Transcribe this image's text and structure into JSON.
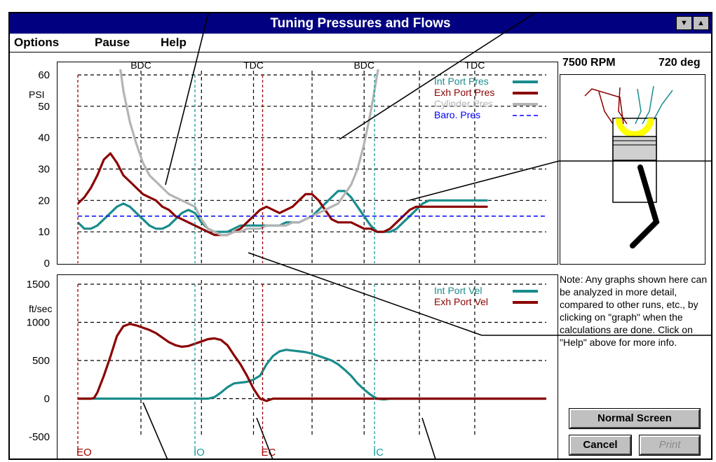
{
  "window": {
    "title": "Tuning Pressures and Flows",
    "minimize_glyph": "▼",
    "maximize_glyph": "▲"
  },
  "menu": {
    "items": [
      {
        "id": "options",
        "label": "Options"
      },
      {
        "id": "pause",
        "label": "Pause"
      },
      {
        "id": "help",
        "label": "Help"
      }
    ]
  },
  "status": {
    "rpm": "7500 RPM",
    "deg": "720 deg"
  },
  "note": "Note:  Any graphs shown here can be analyzed in more detail, compared to other runs, etc., by clicking on \"graph\" when the calculations are done. Click on \"Help\" above for more info.",
  "buttons": {
    "normal_screen": "Normal Screen",
    "cancel": "Cancel",
    "print": "Print"
  },
  "colors": {
    "intake": "#1a8c8c",
    "exhaust": "#8b0000",
    "cylinder": "#b4b4b4",
    "baro": "#0000ff",
    "piston_ring": "#ffff00",
    "io_marker": "#1a9c9c",
    "eo_marker": "#a00000"
  },
  "chart_data": [
    {
      "type": "line",
      "id": "pressure",
      "title": "",
      "xlabel": "",
      "ylabel": "PSI",
      "xlim": [
        0,
        720
      ],
      "ylim": [
        0,
        60
      ],
      "yticks": [
        0,
        10,
        20,
        30,
        40,
        50,
        60
      ],
      "grid": true,
      "legend_position": "top-right",
      "top_labels": [
        {
          "x": 97,
          "label": "BDC"
        },
        {
          "x": 270,
          "label": "TDC"
        },
        {
          "x": 440,
          "label": "BDC"
        },
        {
          "x": 610,
          "label": "TDC"
        }
      ],
      "series": [
        {
          "name": "Int Port Pres",
          "color_key": "intake",
          "x": [
            0,
            10,
            20,
            30,
            40,
            50,
            60,
            70,
            80,
            90,
            100,
            110,
            120,
            130,
            140,
            150,
            160,
            170,
            180,
            190,
            200,
            210,
            220,
            230,
            240,
            250,
            260,
            270,
            280,
            290,
            300,
            310,
            320,
            330,
            340,
            350,
            360,
            370,
            380,
            390,
            400,
            410,
            420,
            430,
            440,
            450,
            460,
            470,
            480,
            490,
            500,
            510,
            520,
            530,
            540,
            550,
            560,
            570,
            580,
            590,
            600,
            610,
            620,
            630
          ],
          "y": [
            13,
            11,
            11,
            12,
            14,
            16,
            18,
            19,
            18,
            16,
            14,
            12,
            11,
            11,
            12,
            14,
            16,
            17,
            16,
            13,
            11,
            10,
            10,
            10,
            11,
            12,
            12,
            12,
            12,
            12,
            12,
            12,
            13,
            13,
            13,
            14,
            15,
            17,
            19,
            21,
            23,
            23,
            21,
            18,
            15,
            12,
            10,
            10,
            10,
            11,
            13,
            15,
            17,
            19,
            20,
            20,
            20,
            20,
            20,
            20,
            20,
            20,
            20,
            20
          ]
        },
        {
          "name": "Exh Port Pres",
          "color_key": "exhaust",
          "x": [
            0,
            10,
            20,
            30,
            40,
            50,
            60,
            70,
            80,
            90,
            100,
            110,
            120,
            130,
            140,
            150,
            160,
            170,
            180,
            190,
            200,
            210,
            220,
            230,
            240,
            250,
            260,
            270,
            280,
            290,
            300,
            310,
            320,
            330,
            340,
            350,
            360,
            370,
            380,
            390,
            400,
            410,
            420,
            430,
            440,
            450,
            460,
            470,
            480,
            490,
            500,
            510,
            520,
            530,
            540,
            550,
            560,
            570,
            580,
            590,
            600,
            610,
            620,
            630
          ],
          "y": [
            19,
            21,
            24,
            28,
            33,
            35,
            32,
            28,
            26,
            24,
            22,
            21,
            20,
            18,
            17,
            15,
            14,
            13,
            12,
            11,
            10,
            9,
            9,
            9,
            10,
            11,
            13,
            15,
            17,
            18,
            17,
            16,
            17,
            18,
            20,
            22,
            22,
            20,
            17,
            14,
            13,
            13,
            13,
            12,
            11,
            11,
            10,
            10,
            11,
            13,
            15,
            17,
            18,
            18,
            18,
            18,
            18,
            18,
            18,
            18,
            18,
            18,
            18,
            18
          ]
        },
        {
          "name": "Cylinder Pres",
          "color_key": "cylinder",
          "x": [
            50,
            60,
            70,
            80,
            90,
            100,
            110,
            120,
            130,
            140,
            150,
            160,
            170,
            180,
            190,
            200,
            210,
            220,
            230,
            240,
            250,
            260,
            270,
            280,
            290,
            300,
            310,
            320,
            330,
            340,
            350,
            360,
            370,
            380,
            390,
            400,
            410,
            420,
            430,
            440,
            450,
            460,
            470,
            480,
            490,
            500
          ],
          "y": [
            85,
            70,
            55,
            45,
            38,
            32,
            28,
            26,
            24,
            22,
            21,
            20,
            19,
            18,
            14,
            11,
            10,
            9,
            9,
            10,
            10,
            11,
            11,
            11,
            12,
            12,
            12,
            12,
            13,
            13,
            14,
            15,
            16,
            17,
            18,
            19,
            22,
            25,
            30,
            38,
            48,
            60,
            72,
            85,
            100,
            120
          ]
        },
        {
          "name": "Baro. Pres",
          "color_key": "baro",
          "dashed": true,
          "x": [
            0,
            720
          ],
          "y": [
            15,
            15
          ]
        }
      ],
      "markers": [
        {
          "x": 0,
          "label": "EO",
          "color_key": "eo_marker"
        },
        {
          "x": 180,
          "label": "IO",
          "color_key": "io_marker"
        },
        {
          "x": 284,
          "label": "EC",
          "color_key": "eo_marker"
        },
        {
          "x": 456,
          "label": "IC",
          "color_key": "io_marker"
        }
      ]
    },
    {
      "type": "line",
      "id": "velocity",
      "title": "",
      "xlabel": "",
      "ylabel": "ft/sec",
      "xlim": [
        0,
        720
      ],
      "ylim": [
        -500,
        1500
      ],
      "yticks": [
        -500,
        0,
        500,
        1000,
        1500
      ],
      "grid": true,
      "legend_position": "top-right",
      "series": [
        {
          "name": "Int Port Vel",
          "color_key": "intake",
          "x": [
            0,
            100,
            200,
            210,
            220,
            230,
            240,
            250,
            260,
            270,
            280,
            290,
            300,
            310,
            320,
            330,
            340,
            350,
            360,
            370,
            380,
            390,
            400,
            410,
            420,
            430,
            440,
            450,
            460,
            470,
            480,
            720
          ],
          "y": [
            0,
            0,
            0,
            20,
            80,
            150,
            200,
            210,
            220,
            250,
            300,
            450,
            560,
            620,
            640,
            630,
            620,
            610,
            590,
            560,
            530,
            500,
            450,
            380,
            300,
            200,
            120,
            50,
            0,
            -10,
            0,
            0
          ]
        },
        {
          "name": "Exh Port Vel",
          "color_key": "exhaust",
          "x": [
            0,
            10,
            20,
            25,
            30,
            40,
            50,
            60,
            70,
            80,
            90,
            100,
            110,
            120,
            130,
            140,
            150,
            160,
            170,
            180,
            190,
            200,
            210,
            220,
            230,
            240,
            250,
            260,
            270,
            280,
            290,
            300,
            720
          ],
          "y": [
            0,
            0,
            0,
            10,
            80,
            300,
            550,
            820,
            950,
            980,
            960,
            930,
            900,
            860,
            800,
            740,
            700,
            680,
            690,
            720,
            750,
            780,
            790,
            770,
            700,
            570,
            450,
            300,
            130,
            0,
            -30,
            0,
            0
          ]
        }
      ]
    }
  ]
}
